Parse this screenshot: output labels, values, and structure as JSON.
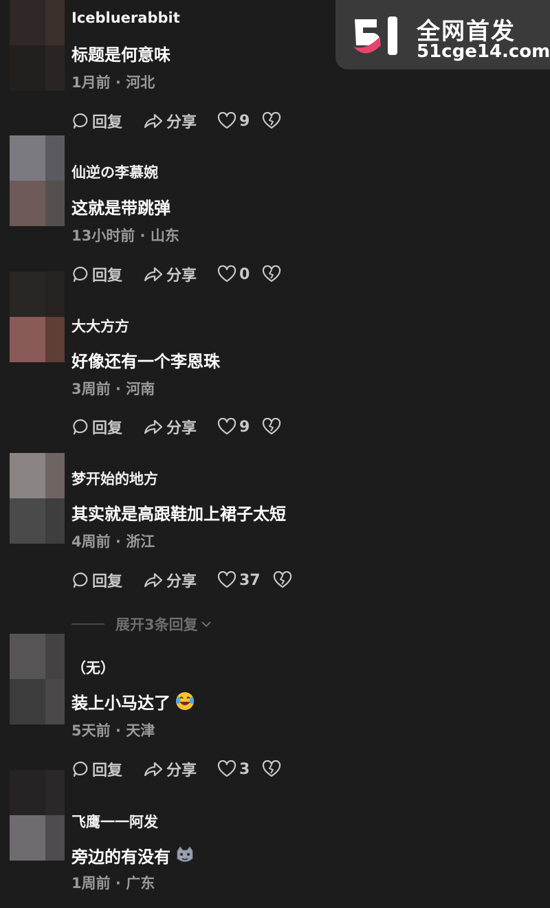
{
  "actions": {
    "reply_label": "回复",
    "share_label": "分享"
  },
  "comments": [
    {
      "username": "Icebluerabbit",
      "text": "标题是何意味",
      "meta": "1月前 · 河北",
      "likes": "9"
    },
    {
      "username": "仙逆の李慕婉",
      "text": "这就是带跳弹",
      "meta": "13小时前 · 山东",
      "likes": "0"
    },
    {
      "username": "大大方方",
      "text": "好像还有一个李恩珠",
      "meta": "3周前 · 河南",
      "likes": "9"
    },
    {
      "username": "梦开始的地方",
      "text": "其实就是高跟鞋加上裙子太短",
      "meta": "4周前 · 浙江",
      "likes": "37"
    },
    {
      "username": "（无）",
      "text": "装上小马达了",
      "meta": "5天前 · 天津",
      "likes": "3",
      "emoji": "laughing-crying-emoji"
    },
    {
      "username": "飞鹰一一阿发",
      "text": "旁边的有没有",
      "meta": "1周前 · 广东",
      "emoji": "cat-emoji"
    }
  ],
  "expand_replies": "展开3条回复",
  "watermark": {
    "line1": "全网首发",
    "line2": "51cge14.com",
    "logo_text": "51"
  },
  "colors": {
    "background": "#1c1c1c",
    "meta": "#9a9a9a",
    "action": "#c8c8c8",
    "logo_pink": "#e8436e"
  },
  "icons": [
    "comment-bubble-icon",
    "share-arrow-icon",
    "heart-icon",
    "broken-heart-icon",
    "chevron-down-icon"
  ]
}
